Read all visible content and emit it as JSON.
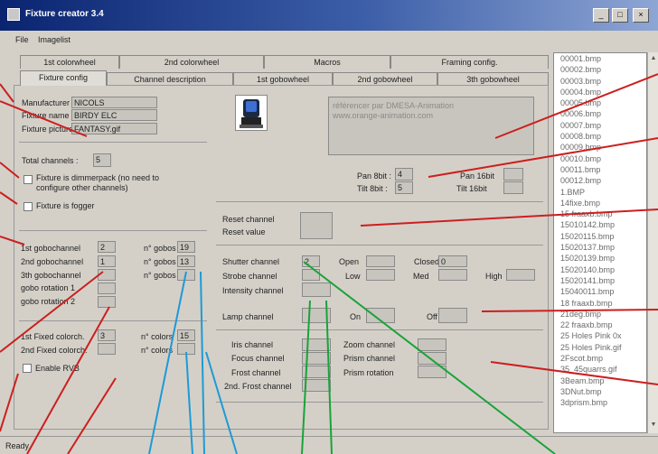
{
  "window": {
    "title": "Fixture creator 3.4"
  },
  "menu": [
    "File",
    "Imagelist"
  ],
  "tabs_top": [
    "1st colorwheel",
    "2nd colorwheel",
    "Macros",
    "Framing config."
  ],
  "tabs_bottom": [
    "Fixture config",
    "Channel description",
    "1st gobowheel",
    "2nd gobowheel",
    "3th gobowheel"
  ],
  "fixture": {
    "manufacturer_label": "Manufacturer :",
    "manufacturer_value": "NICOLS",
    "name_label": "Fixture name :",
    "name_value": "BIRDY ELC",
    "picture_label": "Fixture picture :",
    "picture_value": "FANTASY.gif",
    "total_channels_label": "Total channels :",
    "total_channels_value": "5",
    "dimmerpack_label": "Fixture is dimmerpack (no need to configure other channels)",
    "fogger_label": "Fixture is fogger"
  },
  "description_text": "référencer par DMESA-Animation\nwww.orange-animation.com",
  "pan_tilt": {
    "pan8_label": "Pan 8bit :",
    "pan8_value": "4",
    "tilt8_label": "Tilt 8bit :",
    "tilt8_value": "5",
    "pan16_label": "Pan 16bit",
    "tilt16_label": "Tilt 16bit"
  },
  "reset": {
    "channel_label": "Reset channel",
    "value_label": "Reset value"
  },
  "gobo": {
    "ch1_label": "1st gobochannel",
    "ch1_value": "2",
    "ch2_label": "2nd gobochannel",
    "ch2_value": "1",
    "ch3_label": "3th gobochannel",
    "rot1_label": "gobo rotation 1",
    "rot2_label": "gobo rotation 2",
    "n_gobos_label": "n° gobos",
    "n1_value": "19",
    "n2_value": "13"
  },
  "color": {
    "fixed1_label": "1st Fixed colorch.",
    "fixed1_value": "3",
    "fixed2_label": "2nd Fixed colorch.",
    "n_colors_label": "n° colors",
    "n_colors_value": "15",
    "rgb_label": "Enable RVB"
  },
  "shutter": {
    "shutter_label": "Shutter channel",
    "shutter_value": "2",
    "strobe_label": "Strobe channel",
    "intensity_label": "Intensity channel",
    "open_label": "Open",
    "closed_label": "Closed",
    "closed_value": "0",
    "low_label": "Low",
    "med_label": "Med",
    "high_label": "High"
  },
  "lamp": {
    "channel_label": "Lamp channel",
    "on_label": "On",
    "off_label": "Off"
  },
  "optics": {
    "iris_label": "Iris channel",
    "focus_label": "Focus channel",
    "frost_label": "Frost channel",
    "frost2_label": "2nd. Frost channel",
    "zoom_label": "Zoom channel",
    "prism_label": "Prism channel",
    "prism_rot_label": "Prism rotation"
  },
  "file_list": [
    "00001.bmp",
    "00002.bmp",
    "00003.bmp",
    "00004.bmp",
    "00005.bmp",
    "00006.bmp",
    "00007.bmp",
    "00008.bmp",
    "00009.bmp",
    "00010.bmp",
    "00011.bmp",
    "00012.bmp",
    "1.BMP",
    "14fixe.bmp",
    "15 fraaxb.bmp",
    "15010142.bmp",
    "15020115.bmp",
    "15020137.bmp",
    "15020139.bmp",
    "15020140.bmp",
    "15020141.bmp",
    "15040011.bmp",
    "18 fraaxb.bmp",
    "21deg.bmp",
    "22 fraaxb.bmp",
    "25 Holes Pink 0x",
    "25 Holes Pink.gif",
    "2Fscot.bmp",
    "35_45quarrs.gif",
    "3Beam.bmp",
    "3DNut.bmp",
    "3dprism.bmp"
  ],
  "status": "Ready",
  "colors": {
    "titlebar": "#0a2470",
    "red_annotation": "#cc1f1f",
    "blue_annotation": "#1e9ad6",
    "green_annotation": "#19a33a"
  }
}
